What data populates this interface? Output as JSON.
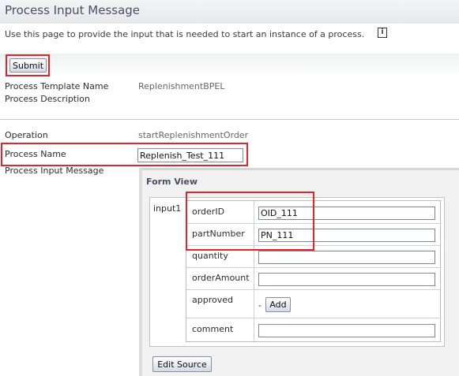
{
  "page": {
    "title": "Process Input Message",
    "description": "Use this page to provide the input that is needed to start an instance of a process.",
    "info_icon_glyph": "i"
  },
  "toolbar": {
    "submit_label": "Submit"
  },
  "details": {
    "template_name_label": "Process Template Name",
    "template_name_value": "ReplenishmentBPEL",
    "description_label": "Process Description",
    "operation_label": "Operation",
    "operation_value": "startReplenishmentOrder",
    "process_name_label": "Process Name",
    "process_name_value": "Replenish_Test_111",
    "input_message_label": "Process Input Message"
  },
  "form_view": {
    "heading": "Form View",
    "root_label": "input1",
    "fields": [
      {
        "label": "orderID",
        "value": "OID_111"
      },
      {
        "label": "partNumber",
        "value": "PN_111"
      },
      {
        "label": "quantity",
        "value": ""
      },
      {
        "label": "orderAmount",
        "value": ""
      },
      {
        "label": "approved",
        "prefix": "-",
        "add_label": "Add"
      },
      {
        "label": "comment",
        "value": ""
      }
    ],
    "edit_source_label": "Edit Source"
  },
  "colors": {
    "highlight": "#e0262b",
    "title": "#4a4f63"
  }
}
